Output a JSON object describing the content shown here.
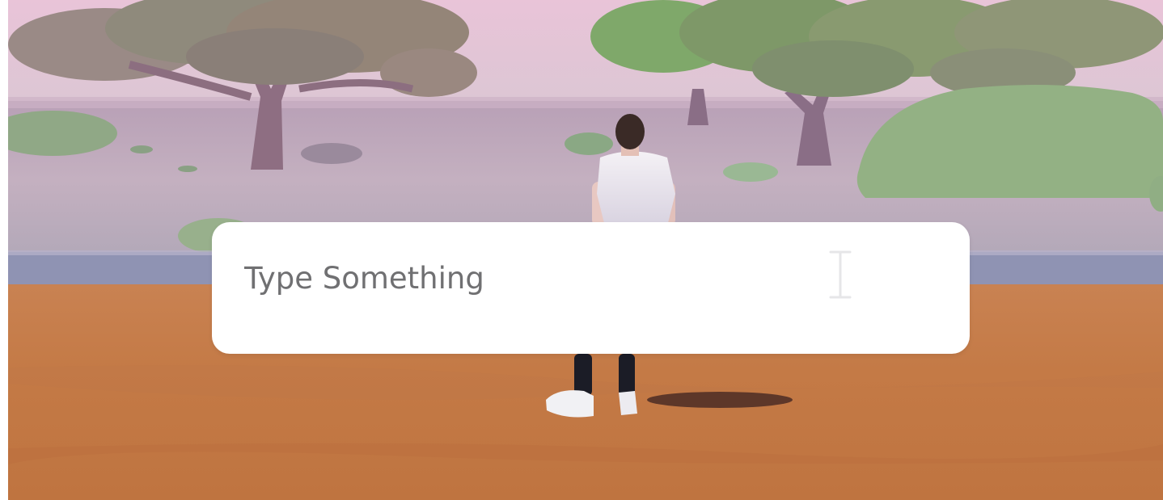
{
  "chat": {
    "placeholder": "Type Something",
    "value": ""
  },
  "icons": {
    "text_cursor": "i-beam-cursor-icon"
  }
}
